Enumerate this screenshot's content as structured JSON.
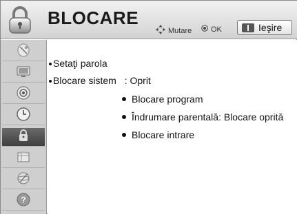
{
  "header": {
    "title": "BLOCARE",
    "hint_move": "Mutare",
    "hint_ok": "OK",
    "exit_label": "Ieşire"
  },
  "sidebar": {
    "items": [
      {
        "icon": "satellite-dish-icon",
        "active": false
      },
      {
        "icon": "monitor-icon",
        "active": false
      },
      {
        "icon": "speaker-icon",
        "active": false
      },
      {
        "icon": "clock-icon",
        "active": false
      },
      {
        "icon": "lock-icon",
        "active": true
      },
      {
        "icon": "options-box-icon",
        "active": false
      },
      {
        "icon": "network-globe-icon",
        "active": false
      },
      {
        "icon": "help-icon",
        "active": false
      }
    ]
  },
  "menu": {
    "set_password": "Setaţi parola",
    "system_lock_label": "Blocare sistem",
    "system_lock_value": ": Oprit",
    "sub_items": [
      "Blocare program",
      "Îndrumare parentală: Blocare oprită",
      "Blocare intrare"
    ]
  },
  "colors": {
    "header_bg": "#e0e0e0",
    "sidebar_bg": "#cfcfcf",
    "sidebar_active": "#4a4a4a",
    "text": "#111111"
  }
}
